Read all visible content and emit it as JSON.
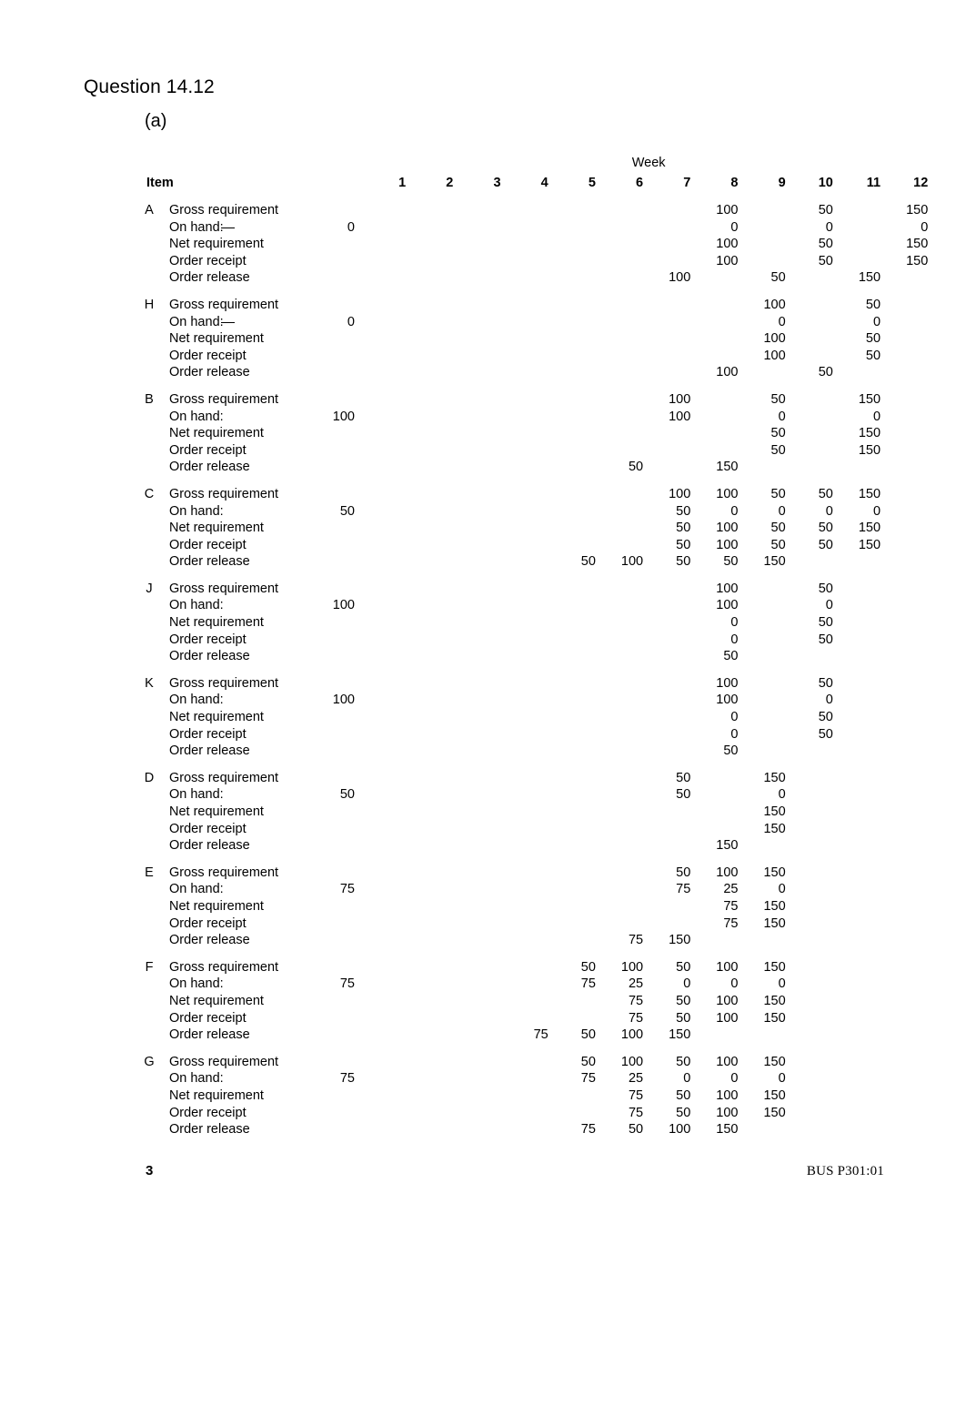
{
  "document": {
    "title": "Question 14.12",
    "part_label": "(a)"
  },
  "footer": {
    "page_number": "3",
    "course_code": "BUS P301:01"
  },
  "table": {
    "week_group_header": "Week",
    "item_header": "Item",
    "week_columns": [
      "1",
      "2",
      "3",
      "4",
      "5",
      "6",
      "7",
      "8",
      "9",
      "10",
      "11",
      "12"
    ],
    "row_labels": {
      "gross": "Gross requirement",
      "on_hand": "On hand:",
      "net": "Net requirement",
      "receipt": "Order receipt",
      "release": "Order release"
    }
  },
  "chart_data": {
    "type": "table",
    "title": "Question 14.12 (a) — MRP records by item",
    "xlabel": "Week",
    "categories": [
      "1",
      "2",
      "3",
      "4",
      "5",
      "6",
      "7",
      "8",
      "9",
      "10",
      "11",
      "12"
    ],
    "row_types": [
      "Gross requirement",
      "On hand:",
      "Net requirement",
      "Order receipt",
      "Order release"
    ],
    "items": [
      {
        "item": "A",
        "on_hand_initial": "0",
        "on_hand_dash": true,
        "rows": {
          "gross": [
            "",
            "",
            "",
            "",
            "",
            "",
            "",
            "100",
            "",
            "50",
            "",
            "150"
          ],
          "on_hand": [
            "",
            "",
            "",
            "",
            "",
            "",
            "",
            "0",
            "",
            "0",
            "",
            "0"
          ],
          "net": [
            "",
            "",
            "",
            "",
            "",
            "",
            "",
            "100",
            "",
            "50",
            "",
            "150"
          ],
          "receipt": [
            "",
            "",
            "",
            "",
            "",
            "",
            "",
            "100",
            "",
            "50",
            "",
            "150"
          ],
          "release": [
            "",
            "",
            "",
            "",
            "",
            "",
            "100",
            "",
            "50",
            "",
            "150",
            ""
          ]
        }
      },
      {
        "item": "H",
        "on_hand_initial": "0",
        "on_hand_dash": true,
        "rows": {
          "gross": [
            "",
            "",
            "",
            "",
            "",
            "",
            "",
            "",
            "100",
            "",
            "50",
            ""
          ],
          "on_hand": [
            "",
            "",
            "",
            "",
            "",
            "",
            "",
            "",
            "0",
            "",
            "0",
            ""
          ],
          "net": [
            "",
            "",
            "",
            "",
            "",
            "",
            "",
            "",
            "100",
            "",
            "50",
            ""
          ],
          "receipt": [
            "",
            "",
            "",
            "",
            "",
            "",
            "",
            "",
            "100",
            "",
            "50",
            ""
          ],
          "release": [
            "",
            "",
            "",
            "",
            "",
            "",
            "",
            "100",
            "",
            "50",
            "",
            ""
          ]
        }
      },
      {
        "item": "B",
        "on_hand_initial": "100",
        "on_hand_dash": false,
        "rows": {
          "gross": [
            "",
            "",
            "",
            "",
            "",
            "",
            "100",
            "",
            "50",
            "",
            "150",
            ""
          ],
          "on_hand": [
            "",
            "",
            "",
            "",
            "",
            "",
            "100",
            "",
            "0",
            "",
            "0",
            ""
          ],
          "net": [
            "",
            "",
            "",
            "",
            "",
            "",
            "",
            "",
            "50",
            "",
            "150",
            ""
          ],
          "receipt": [
            "",
            "",
            "",
            "",
            "",
            "",
            "",
            "",
            "50",
            "",
            "150",
            ""
          ],
          "release": [
            "",
            "",
            "",
            "",
            "",
            "50",
            "",
            "150",
            "",
            "",
            "",
            ""
          ]
        }
      },
      {
        "item": "C",
        "on_hand_initial": "50",
        "on_hand_dash": false,
        "rows": {
          "gross": [
            "",
            "",
            "",
            "",
            "",
            "",
            "100",
            "100",
            "50",
            "50",
            "150",
            ""
          ],
          "on_hand": [
            "",
            "",
            "",
            "",
            "",
            "",
            "50",
            "0",
            "0",
            "0",
            "0",
            ""
          ],
          "net": [
            "",
            "",
            "",
            "",
            "",
            "",
            "50",
            "100",
            "50",
            "50",
            "150",
            ""
          ],
          "receipt": [
            "",
            "",
            "",
            "",
            "",
            "",
            "50",
            "100",
            "50",
            "50",
            "150",
            ""
          ],
          "release": [
            "",
            "",
            "",
            "",
            "50",
            "100",
            "50",
            "50",
            "150",
            "",
            "",
            ""
          ]
        }
      },
      {
        "item": "J",
        "on_hand_initial": "100",
        "on_hand_dash": false,
        "rows": {
          "gross": [
            "",
            "",
            "",
            "",
            "",
            "",
            "",
            "100",
            "",
            "50",
            "",
            ""
          ],
          "on_hand": [
            "",
            "",
            "",
            "",
            "",
            "",
            "",
            "100",
            "",
            "0",
            "",
            ""
          ],
          "net": [
            "",
            "",
            "",
            "",
            "",
            "",
            "",
            "0",
            "",
            "50",
            "",
            ""
          ],
          "receipt": [
            "",
            "",
            "",
            "",
            "",
            "",
            "",
            "0",
            "",
            "50",
            "",
            ""
          ],
          "release": [
            "",
            "",
            "",
            "",
            "",
            "",
            "",
            "50",
            "",
            "",
            "",
            ""
          ]
        }
      },
      {
        "item": "K",
        "on_hand_initial": "100",
        "on_hand_dash": false,
        "rows": {
          "gross": [
            "",
            "",
            "",
            "",
            "",
            "",
            "",
            "100",
            "",
            "50",
            "",
            ""
          ],
          "on_hand": [
            "",
            "",
            "",
            "",
            "",
            "",
            "",
            "100",
            "",
            "0",
            "",
            ""
          ],
          "net": [
            "",
            "",
            "",
            "",
            "",
            "",
            "",
            "0",
            "",
            "50",
            "",
            ""
          ],
          "receipt": [
            "",
            "",
            "",
            "",
            "",
            "",
            "",
            "0",
            "",
            "50",
            "",
            ""
          ],
          "release": [
            "",
            "",
            "",
            "",
            "",
            "",
            "",
            "50",
            "",
            "",
            "",
            ""
          ]
        }
      },
      {
        "item": "D",
        "on_hand_initial": "50",
        "on_hand_dash": false,
        "rows": {
          "gross": [
            "",
            "",
            "",
            "",
            "",
            "",
            "50",
            "",
            "150",
            "",
            "",
            ""
          ],
          "on_hand": [
            "",
            "",
            "",
            "",
            "",
            "",
            "50",
            "",
            "0",
            "",
            "",
            ""
          ],
          "net": [
            "",
            "",
            "",
            "",
            "",
            "",
            "",
            "",
            "150",
            "",
            "",
            ""
          ],
          "receipt": [
            "",
            "",
            "",
            "",
            "",
            "",
            "",
            "",
            "150",
            "",
            "",
            ""
          ],
          "release": [
            "",
            "",
            "",
            "",
            "",
            "",
            "",
            "150",
            "",
            "",
            "",
            ""
          ]
        }
      },
      {
        "item": "E",
        "on_hand_initial": "75",
        "on_hand_dash": false,
        "rows": {
          "gross": [
            "",
            "",
            "",
            "",
            "",
            "",
            "50",
            "100",
            "150",
            "",
            "",
            ""
          ],
          "on_hand": [
            "",
            "",
            "",
            "",
            "",
            "",
            "75",
            "25",
            "0",
            "",
            "",
            ""
          ],
          "net": [
            "",
            "",
            "",
            "",
            "",
            "",
            "",
            "75",
            "150",
            "",
            "",
            ""
          ],
          "receipt": [
            "",
            "",
            "",
            "",
            "",
            "",
            "",
            "75",
            "150",
            "",
            "",
            ""
          ],
          "release": [
            "",
            "",
            "",
            "",
            "",
            "75",
            "150",
            "",
            "",
            "",
            "",
            ""
          ]
        }
      },
      {
        "item": "F",
        "on_hand_initial": "75",
        "on_hand_dash": false,
        "rows": {
          "gross": [
            "",
            "",
            "",
            "",
            "50",
            "100",
            "50",
            "100",
            "150",
            "",
            "",
            ""
          ],
          "on_hand": [
            "",
            "",
            "",
            "",
            "75",
            "25",
            "0",
            "0",
            "0",
            "",
            "",
            ""
          ],
          "net": [
            "",
            "",
            "",
            "",
            "",
            "75",
            "50",
            "100",
            "150",
            "",
            "",
            ""
          ],
          "receipt": [
            "",
            "",
            "",
            "",
            "",
            "75",
            "50",
            "100",
            "150",
            "",
            "",
            ""
          ],
          "release": [
            "",
            "",
            "",
            "75",
            "50",
            "100",
            "150",
            "",
            "",
            "",
            "",
            ""
          ]
        }
      },
      {
        "item": "G",
        "on_hand_initial": "75",
        "on_hand_dash": false,
        "rows": {
          "gross": [
            "",
            "",
            "",
            "",
            "50",
            "100",
            "50",
            "100",
            "150",
            "",
            "",
            ""
          ],
          "on_hand": [
            "",
            "",
            "",
            "",
            "75",
            "25",
            "0",
            "0",
            "0",
            "",
            "",
            ""
          ],
          "net": [
            "",
            "",
            "",
            "",
            "",
            "75",
            "50",
            "100",
            "150",
            "",
            "",
            ""
          ],
          "receipt": [
            "",
            "",
            "",
            "",
            "",
            "75",
            "50",
            "100",
            "150",
            "",
            "",
            ""
          ],
          "release": [
            "",
            "",
            "",
            "",
            "75",
            "50",
            "100",
            "150",
            "",
            "",
            "",
            ""
          ]
        }
      }
    ]
  }
}
